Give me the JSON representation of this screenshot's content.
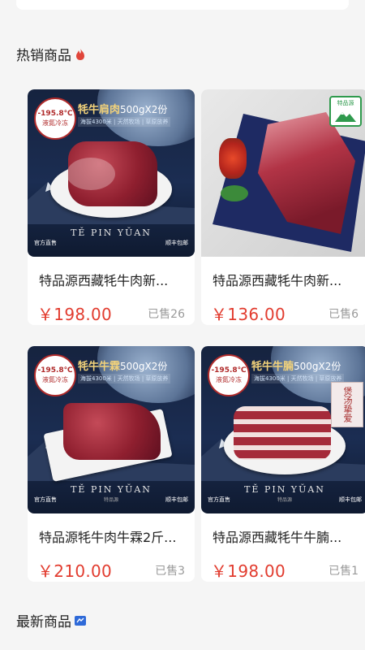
{
  "sections": {
    "hot": {
      "title": "热销商品",
      "icon": "fire-icon",
      "icon_color": "#e0453a"
    },
    "new": {
      "title": "最新商品",
      "icon": "flag-icon",
      "icon_color": "#2f6ad8"
    }
  },
  "products": [
    {
      "name": "特品源西藏牦牛肉新...",
      "price": "￥198.00",
      "sold": "已售26",
      "banner": {
        "badge_temp": "-195.8℃",
        "badge_sub": "液氮冷冻",
        "title": "牦牛肩肉",
        "spec": "500gX2份",
        "sub": "海拔4300米 | 天然牧场 | 草原放养",
        "brand": "TĚ PIN YŬAN",
        "foot_left": "官方直售",
        "foot_right": "顺丰包邮"
      }
    },
    {
      "name": "特品源西藏牦牛肉新...",
      "price": "￥136.00",
      "sold": "已售6",
      "photo": {
        "logo_text": "特品源"
      }
    },
    {
      "name": "特品源牦牛肉牛霖2斤...",
      "price": "￥210.00",
      "sold": "已售3",
      "banner": {
        "badge_temp": "-195.8℃",
        "badge_sub": "液氮冷冻",
        "title": "牦牛牛霖",
        "spec": "500gX2份",
        "sub": "海拔4300米 | 天然牧场 | 草原放养",
        "brand": "TĚ PIN YŬAN",
        "brand_cn": "特品源",
        "foot_left": "官方直售",
        "foot_right": "顺丰包邮"
      }
    },
    {
      "name": "特品源西藏牦牛牛腩...",
      "price": "￥198.00",
      "sold": "已售1",
      "banner": {
        "badge_temp": "-195.8℃",
        "badge_sub": "液氮冷冻",
        "title": "牦牛牛腩",
        "spec": "500gX2份",
        "sub": "海拔4300米 | 天然牧场 | 草原放养",
        "brand": "TĚ PIN YŬAN",
        "brand_cn": "特品源",
        "foot_left": "官方直售",
        "foot_right": "顺丰包邮",
        "stamp": "煲汤挚爱"
      }
    }
  ]
}
